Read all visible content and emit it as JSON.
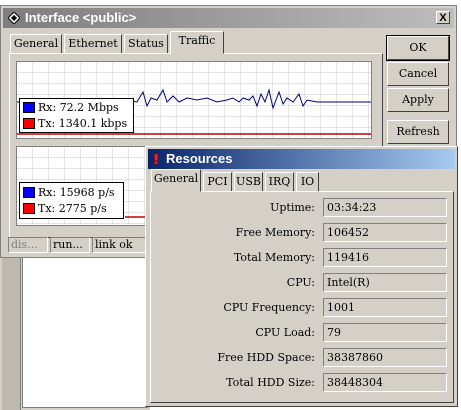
{
  "interface_window": {
    "title": "Interface <public>",
    "close_label": "X",
    "tabs": [
      "General",
      "Ethernet",
      "Status",
      "Traffic"
    ],
    "buttons": {
      "ok": "OK",
      "cancel": "Cancel",
      "apply": "Apply",
      "refresh": "Refresh"
    },
    "bits_graph": {
      "rx": "Rx: 72.2 Mbps",
      "tx": "Tx: 1340.1 kbps"
    },
    "packets_graph": {
      "rx": "Rx: 15968 p/s",
      "tx": "Tx: 2775 p/s"
    },
    "status_bar": [
      "dis...",
      "run...",
      "link ok"
    ]
  },
  "resources_window": {
    "title": "Resources",
    "tabs": [
      "General",
      "PCI",
      "USB",
      "IRQ",
      "IO"
    ],
    "fields": [
      {
        "label": "Uptime:",
        "value": "03:34:23"
      },
      {
        "label": "Free Memory:",
        "value": "106452"
      },
      {
        "label": "Total Memory:",
        "value": "119416"
      },
      {
        "label": "CPU:",
        "value": "Intel(R)"
      },
      {
        "label": "CPU Frequency:",
        "value": "1001"
      },
      {
        "label": "CPU Load:",
        "value": "79"
      },
      {
        "label": "Free HDD Space:",
        "value": "38387860"
      },
      {
        "label": "Total HDD Size:",
        "value": "38448304"
      }
    ]
  },
  "colors": {
    "rx": "#0000ff",
    "tx": "#ff0000",
    "rx_line": "#000080",
    "tx_line": "#c00000"
  }
}
